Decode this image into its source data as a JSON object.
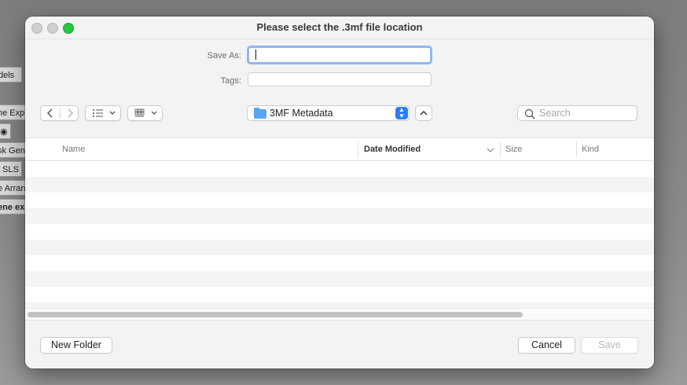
{
  "background": {
    "panel_items": [
      "dels",
      "ne Exp",
      "sk Gen",
      "SLS",
      "e Arran",
      "ene ex"
    ]
  },
  "dialog": {
    "title": "Please select the .3mf file location",
    "save_as_label": "Save As:",
    "save_as_value": "",
    "tags_label": "Tags:",
    "tags_value": "",
    "location": "3MF Metadata",
    "search_placeholder": "Search",
    "columns": {
      "name": "Name",
      "date_modified": "Date Modified",
      "size": "Size",
      "kind": "Kind"
    },
    "new_folder": "New Folder",
    "cancel": "Cancel",
    "save": "Save"
  },
  "colors": {
    "accent": "#2f7cf6",
    "focus_ring": "#8fb6f2",
    "zoom_button": "#27c840"
  },
  "icons": {
    "back": "chevron-left-icon",
    "forward": "chevron-right-icon",
    "list_view": "list-icon",
    "grid_view": "grid-icon",
    "folder": "folder-icon",
    "search": "magnifier-icon"
  }
}
